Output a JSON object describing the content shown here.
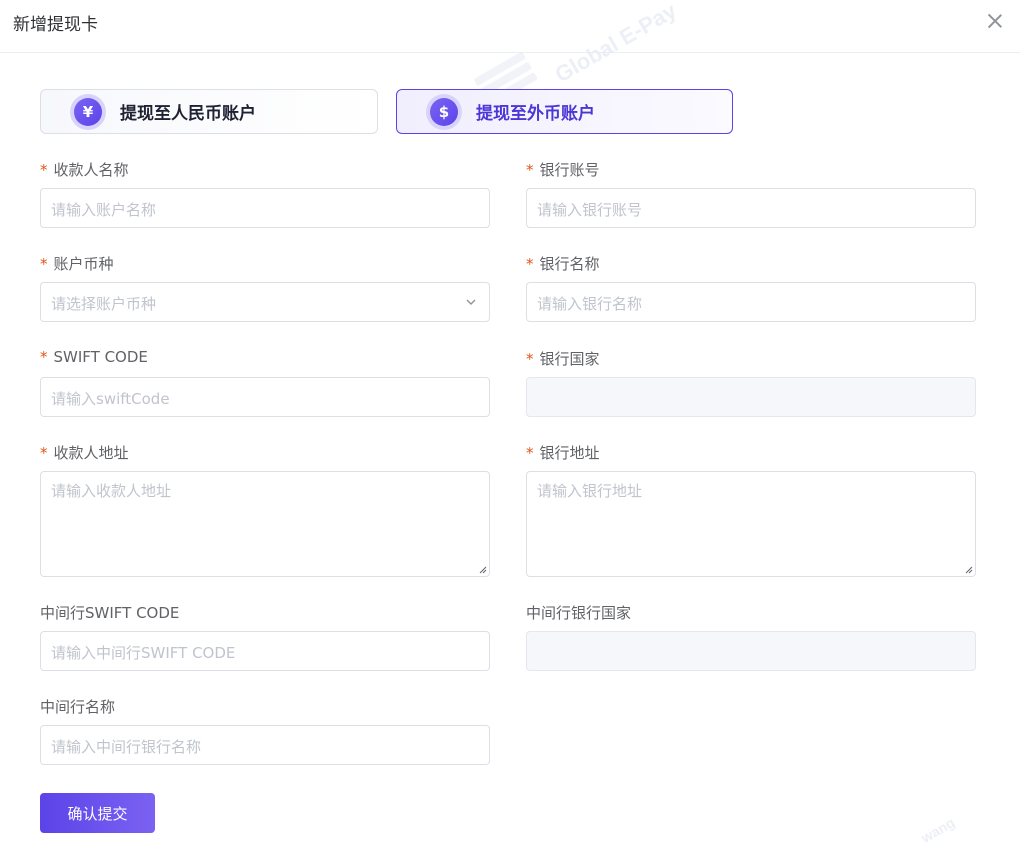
{
  "dialog": {
    "title": "新增提现卡"
  },
  "watermark": {
    "text_1": "Global E-Pay",
    "text_2": "wang"
  },
  "account_types": [
    {
      "label": "提现至人民币账户",
      "icon": "yuan-icon",
      "glyph": "¥",
      "selected": false
    },
    {
      "label": "提现至外币账户",
      "icon": "dollar-icon",
      "glyph": "$",
      "selected": true
    }
  ],
  "form": {
    "required_mark": "*",
    "payee_name": {
      "label": "收款人名称",
      "placeholder": "请输入账户名称",
      "value": ""
    },
    "bank_account": {
      "label": "银行账号",
      "placeholder": "请输入银行账号",
      "value": ""
    },
    "account_currency": {
      "label": "账户币种",
      "placeholder": "请选择账户币种",
      "value": ""
    },
    "bank_name": {
      "label": "银行名称",
      "placeholder": "请输入银行名称",
      "value": ""
    },
    "swift_code": {
      "label": "SWIFT CODE",
      "placeholder": "请输入swiftCode",
      "value": ""
    },
    "bank_country": {
      "label": "银行国家",
      "placeholder": "",
      "value": "",
      "disabled": true
    },
    "payee_address": {
      "label": "收款人地址",
      "placeholder": "请输入收款人地址",
      "value": ""
    },
    "bank_address": {
      "label": "银行地址",
      "placeholder": "请输入银行地址",
      "value": ""
    },
    "intermediary_swift": {
      "label": "中间行SWIFT CODE",
      "placeholder": "请输入中间行SWIFT CODE",
      "value": ""
    },
    "intermediary_country": {
      "label": "中间行银行国家",
      "placeholder": "",
      "value": "",
      "disabled": true
    },
    "intermediary_name": {
      "label": "中间行名称",
      "placeholder": "请输入中间行银行名称",
      "value": ""
    }
  },
  "actions": {
    "submit_label": "确认提交"
  },
  "colors": {
    "accent": "#5b43e8",
    "required": "#e0561c",
    "placeholder": "#c0c4cc"
  }
}
